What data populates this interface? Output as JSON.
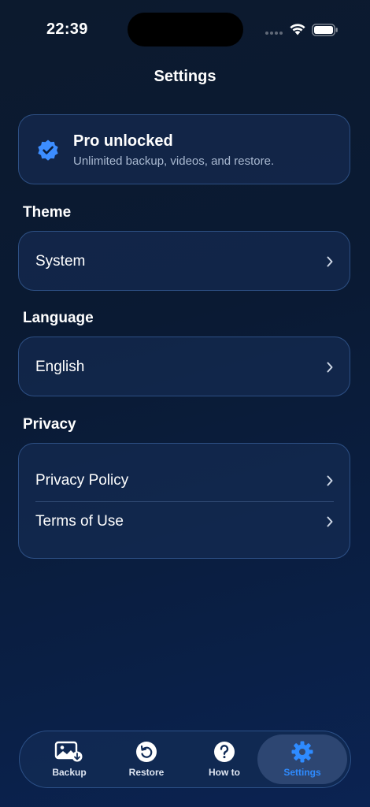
{
  "status_bar": {
    "time": "22:39"
  },
  "header": {
    "title": "Settings"
  },
  "pro_card": {
    "title": "Pro unlocked",
    "subtitle": "Unlimited backup, videos, and restore.",
    "icon": "verified-badge-icon"
  },
  "theme": {
    "label": "Theme",
    "value": "System"
  },
  "language": {
    "label": "Language",
    "value": "English"
  },
  "privacy": {
    "label": "Privacy",
    "items": [
      {
        "label": "Privacy Policy"
      },
      {
        "label": "Terms of Use"
      }
    ]
  },
  "tabbar": {
    "tabs": [
      {
        "label": "Backup",
        "icon": "photo-download-icon"
      },
      {
        "label": "Restore",
        "icon": "restore-icon"
      },
      {
        "label": "How to",
        "icon": "question-icon"
      },
      {
        "label": "Settings",
        "icon": "gear-icon",
        "active": true
      }
    ]
  },
  "colors": {
    "accent": "#2e8bff",
    "background": "#0a1a33",
    "card": "#162d55",
    "subtitle": "#a9b9d1"
  }
}
